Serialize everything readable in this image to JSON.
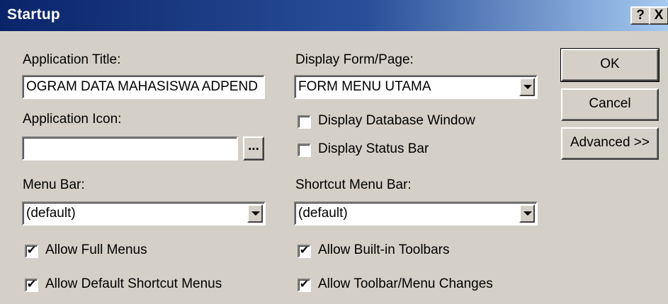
{
  "titlebar": {
    "title": "Startup",
    "help": "?",
    "close": "X"
  },
  "app_title": {
    "label": "Application Title:",
    "value": "OGRAM DATA MAHASISWA ADPEND"
  },
  "app_icon": {
    "label": "Application Icon:",
    "value": "",
    "browse": "..."
  },
  "menu_bar": {
    "label": "Menu Bar:",
    "value": "(default)"
  },
  "display_form": {
    "label": "Display Form/Page:",
    "value": "FORM MENU UTAMA"
  },
  "shortcut_menu_bar": {
    "label": "Shortcut Menu Bar:",
    "value": "(default)"
  },
  "checks": {
    "display_db_window": {
      "label": "Display Database Window",
      "checked": false
    },
    "display_status_bar": {
      "label": "Display Status Bar",
      "checked": false
    },
    "allow_full_menus": {
      "label": "Allow Full Menus",
      "checked": true
    },
    "allow_default_shortcut": {
      "label": "Allow Default Shortcut Menus",
      "checked": true
    },
    "allow_builtin_toolbars": {
      "label": "Allow Built-in Toolbars",
      "checked": true
    },
    "allow_toolbar_changes": {
      "label": "Allow Toolbar/Menu Changes",
      "checked": true
    }
  },
  "buttons": {
    "ok": "OK",
    "cancel": "Cancel",
    "advanced": "Advanced >>"
  },
  "checkmark": "✔",
  "colors": {
    "titlebar_start": "#0a246a",
    "titlebar_end": "#a6caf0",
    "face": "#d4d0c8"
  }
}
